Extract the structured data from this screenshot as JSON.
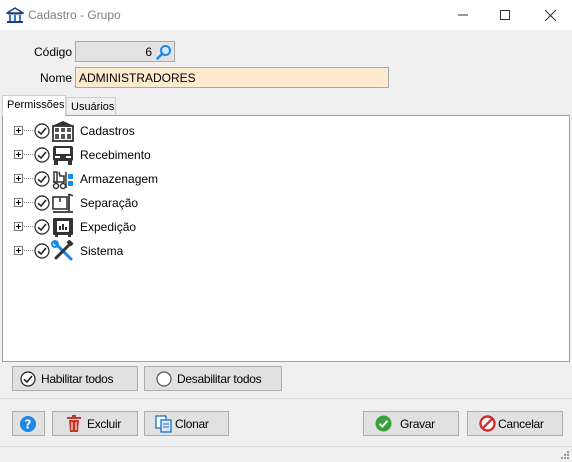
{
  "window": {
    "title": "Cadastro - Grupo",
    "title_icon": "bank-building-icon",
    "controls": [
      "minimize-icon",
      "maximize-icon",
      "close-icon"
    ]
  },
  "form": {
    "codigo_label": "Código",
    "codigo_value": "6",
    "nome_label": "Nome",
    "nome_value": "ADMINISTRADORES"
  },
  "tabs": [
    {
      "label": "Permissões",
      "active": true
    },
    {
      "label": "Usuários",
      "active": false
    }
  ],
  "tree": {
    "items": [
      {
        "label": "Cadastros",
        "icon": "shelves-icon",
        "checked": true
      },
      {
        "label": "Recebimento",
        "icon": "truck-icon",
        "checked": true
      },
      {
        "label": "Armazenagem",
        "icon": "forklift-icon",
        "checked": true
      },
      {
        "label": "Separação",
        "icon": "picking-box-icon",
        "checked": true
      },
      {
        "label": "Expedição",
        "icon": "shipping-box-icon",
        "checked": true
      },
      {
        "label": "Sistema",
        "icon": "tools-icon",
        "checked": true
      }
    ]
  },
  "permission_buttons": {
    "enable_all": "Habilitar todos",
    "disable_all": "Desabilitar todos"
  },
  "actions": {
    "help_icon": "help-icon",
    "delete": "Excluir",
    "clone": "Clonar",
    "save": "Gravar",
    "cancel": "Cancelar"
  },
  "colors": {
    "nome_field_bg": "#fdebd0",
    "codigo_field_bg": "#e3e3e3",
    "help_blue": "#1e88e5",
    "save_green": "#3aa03a",
    "cancel_red": "#d32f2f",
    "delete_red": "#c0392b"
  }
}
